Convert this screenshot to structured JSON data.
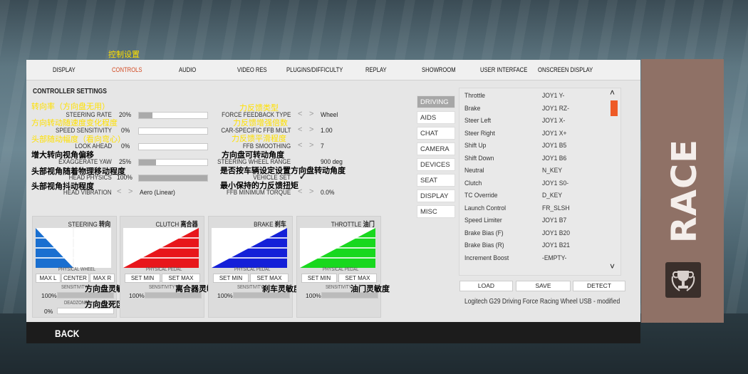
{
  "annotation_titles": {
    "controls_cn": "控制设置"
  },
  "tabs": [
    "DISPLAY",
    "CONTROLS",
    "AUDIO",
    "VIDEO RES",
    "PLUGINS/DIFFICULTY",
    "REPLAY",
    "SHOWROOM",
    "USER INTERFACE",
    "ONSCREEN DISPLAY"
  ],
  "active_tab": "CONTROLS",
  "section_title": "CONTROLLER SETTINGS",
  "left_rows": [
    {
      "label": "STEERING RATE",
      "value": "20%",
      "fill": 0.2,
      "cn": "转向率（方向盘无用）"
    },
    {
      "label": "SPEED SENSITIVITY",
      "value": "0%",
      "fill": 0.0,
      "cn": "方向转动随速度变化程度"
    },
    {
      "label": "LOOK AHEAD",
      "value": "0%",
      "fill": 0.0,
      "cn": "头部随动幅度（看向弯心）"
    },
    {
      "label": "EXAGGERATE YAW",
      "value": "25%",
      "fill": 0.25,
      "cn": "增大转向视角偏移"
    },
    {
      "label": "HEAD PHYSICS",
      "value": "100%",
      "fill": 1.0,
      "cn": "头部视角随着物理移动程度"
    },
    {
      "label": "HEAD VIBRATION",
      "value": "Aero (Linear)",
      "cn": "头部视角抖动程度"
    }
  ],
  "right_rows": [
    {
      "label": "FORCE FEEDBACK TYPE",
      "value": "Wheel",
      "cn": "力反馈类型"
    },
    {
      "label": "CAR-SPECIFIC FFB MULT",
      "value": "1.00",
      "cn": "力反馈增强倍数"
    },
    {
      "label": "FFB SMOOTHING",
      "value": "7",
      "cn": "力反馈平滑程度"
    },
    {
      "label": "STEERING WHEEL RANGE",
      "value": "900 deg",
      "cn": "方向盘可转动角度"
    },
    {
      "label": "VEHICLE SET",
      "value": "✓",
      "cn": "是否按车辆设定设置方向盘转动角度"
    },
    {
      "label": "FFB MINIMUM TORQUE",
      "value": "0.0%",
      "cn": "最小保持的力反馈扭矩"
    }
  ],
  "blocks": [
    {
      "name": "STEERING",
      "cn": "转向",
      "color": "#1a6fd0",
      "buttons": [
        "MAX L",
        "CENTER",
        "MAX R"
      ],
      "xlabel": "PHYSICAL WHEEL",
      "ylabel": "VIRTUAL WHEEL",
      "sensitivity": "100%",
      "sens_cn": "方向盘灵敏度",
      "deadzone": "0%",
      "dz_label": "DEADZONE",
      "dz_cn": "方向盘死区"
    },
    {
      "name": "CLUTCH",
      "cn": "离合器",
      "color": "#e8161b",
      "buttons": [
        "SET MIN",
        "SET MAX"
      ],
      "xlabel": "PHYSICAL PEDAL",
      "ylabel": "VIRTUAL PEDAL",
      "sensitivity": "100%",
      "sens_cn": "离合器灵敏度"
    },
    {
      "name": "BRAKE",
      "cn": "刹车",
      "color": "#1420d8",
      "buttons": [
        "SET MIN",
        "SET MAX"
      ],
      "xlabel": "PHYSICAL PEDAL",
      "ylabel": "VIRTUAL PEDAL",
      "sensitivity": "100%",
      "sens_cn": "刹车灵敏度"
    },
    {
      "name": "THROTTLE",
      "cn": "油门",
      "color": "#18d81e",
      "buttons": [
        "SET MIN",
        "SET MAX"
      ],
      "xlabel": "PHYSICAL PEDAL",
      "ylabel": "VIRTUAL PEDAL",
      "sensitivity": "100%",
      "sens_cn": "油门灵敏度"
    }
  ],
  "sensitivity_label": "SENSITIVITY",
  "side_tabs": [
    "DRIVING",
    "AIDS",
    "CHAT",
    "CAMERA",
    "DEVICES",
    "SEAT",
    "DISPLAY",
    "MISC"
  ],
  "active_side_tab": "DRIVING",
  "bindings": [
    {
      "name": "Throttle",
      "value": "JOY1 Y-"
    },
    {
      "name": "Brake",
      "value": "JOY1 RZ-"
    },
    {
      "name": "Steer Left",
      "value": "JOY1 X-"
    },
    {
      "name": "Steer Right",
      "value": "JOY1 X+"
    },
    {
      "name": "Shift Up",
      "value": "JOY1 B5"
    },
    {
      "name": "Shift Down",
      "value": "JOY1 B6"
    },
    {
      "name": "Neutral",
      "value": "N_KEY"
    },
    {
      "name": "Clutch",
      "value": "JOY1 S0-"
    },
    {
      "name": "TC Override",
      "value": "D_KEY"
    },
    {
      "name": "Launch Control",
      "value": "FR_SLSH"
    },
    {
      "name": "Speed Limiter",
      "value": "JOY1 B7"
    },
    {
      "name": "Brake Bias (F)",
      "value": "JOY1 B20"
    },
    {
      "name": "Brake Bias (R)",
      "value": "JOY1 B21"
    },
    {
      "name": "Increment Boost",
      "value": "-EMPTY-"
    }
  ],
  "actions": {
    "load": "LOAD",
    "save": "SAVE",
    "detect": "DETECT"
  },
  "device_name": "Logitech G29 Driving Force Racing Wheel USB - modified",
  "back_label": "BACK",
  "race_label": "RACE",
  "colors": {
    "accent": "#d24a22",
    "race_bg": "#8f7166",
    "scroll_thumb": "#ee5a26"
  }
}
